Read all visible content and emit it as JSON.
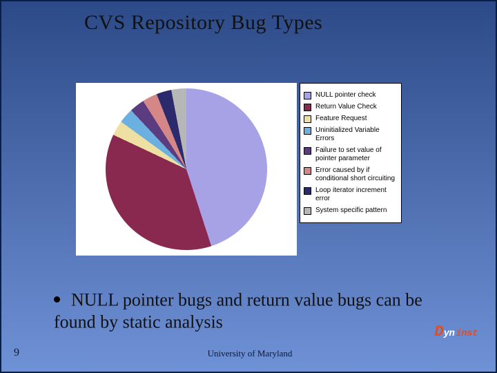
{
  "title": "CVS Repository Bug Types",
  "chart_data": {
    "type": "pie",
    "categories": [
      "NULL pointer check",
      "Return Value Check",
      "Feature Request",
      "Uninitialized Variable Errors",
      "Failure to set value of pointer parameter",
      "Error caused by if conditional short circuiting",
      "Loop iterator increment error",
      "System specific pattern"
    ],
    "values": [
      45,
      37,
      3,
      3,
      3,
      3,
      3,
      3
    ],
    "colors": [
      "#a7a2e6",
      "#8a294f",
      "#eedfa2",
      "#6bb0e0",
      "#5c3c80",
      "#d58787",
      "#2b2a6c",
      "#b7b7b7"
    ],
    "title": "CVS Repository Bug Types"
  },
  "legend": {
    "items": [
      {
        "label": "NULL pointer check"
      },
      {
        "label": "Return Value Check"
      },
      {
        "label": "Feature Request"
      },
      {
        "label": "Uninitialized Variable Errors"
      },
      {
        "label": "Failure to set value of pointer parameter"
      },
      {
        "label": "Error caused by if conditional short circuiting"
      },
      {
        "label": "Loop iterator increment error"
      },
      {
        "label": "System specific pattern"
      }
    ]
  },
  "bullet_text": "NULL pointer bugs and return value bugs can be found by static analysis",
  "slide_number": "9",
  "footer": "University of Maryland",
  "logo": {
    "prefix": "D",
    "mid": "yn",
    "suffix": "inst"
  }
}
